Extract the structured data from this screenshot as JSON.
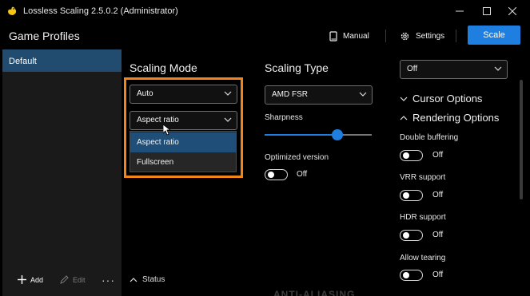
{
  "window": {
    "title": "Lossless Scaling 2.5.0.2 (Administrator)"
  },
  "header": {
    "title": "Game Profiles",
    "manual_label": "Manual",
    "settings_label": "Settings",
    "scale_label": "Scale"
  },
  "sidebar": {
    "profiles": [
      "Default"
    ],
    "add_label": "Add",
    "edit_label": "Edit",
    "more_label": "···"
  },
  "scaling_mode": {
    "title": "Scaling Mode",
    "mode_value": "Auto",
    "fit_value": "Aspect ratio",
    "options": [
      "Aspect ratio",
      "Fullscreen"
    ]
  },
  "scaling_type": {
    "title": "Scaling Type",
    "type_value": "AMD FSR",
    "sharpness_label": "Sharpness",
    "sharpness_value": 0.68,
    "optimized_label": "Optimized version",
    "optimized_state": "Off"
  },
  "right_panel": {
    "top_dropdown": "Off",
    "cursor_options": "Cursor Options",
    "rendering_options": "Rendering Options",
    "double_buffering": {
      "label": "Double buffering",
      "state": "Off"
    },
    "vrr_support": {
      "label": "VRR support",
      "state": "Off"
    },
    "hdr_support": {
      "label": "HDR support",
      "state": "Off"
    },
    "allow_tearing": {
      "label": "Allow tearing",
      "state": "Off"
    }
  },
  "status_label": "Status",
  "background_text": "ANTI-ALIASING",
  "colors": {
    "accent": "#1e7fe0",
    "highlight": "#f2851a",
    "selected_profile": "#224b70"
  }
}
